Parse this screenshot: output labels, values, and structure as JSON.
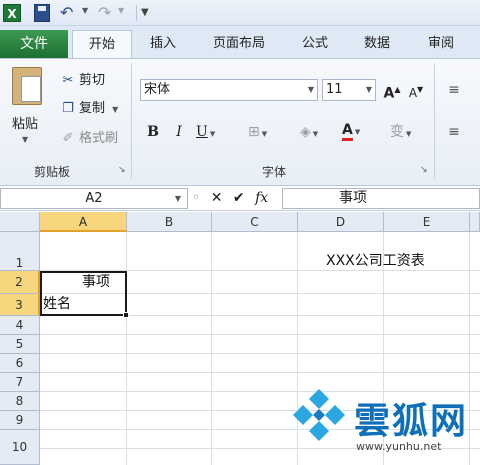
{
  "qat": {
    "logo_letter": "X"
  },
  "tabs": [
    {
      "label": "文件"
    },
    {
      "label": "开始"
    },
    {
      "label": "插入"
    },
    {
      "label": "页面布局"
    },
    {
      "label": "公式"
    },
    {
      "label": "数据"
    },
    {
      "label": "审阅"
    }
  ],
  "ribbon": {
    "clipboard": {
      "paste_label": "粘贴",
      "cut_label": "剪切",
      "copy_label": "复制",
      "format_painter_label": "格式刷",
      "group_label": "剪贴板"
    },
    "font": {
      "font_name": "宋体",
      "font_size": "11",
      "bold": "B",
      "italic": "I",
      "underline": "U",
      "grow": "A",
      "shrink": "A",
      "font_color_letter": "A",
      "phonetic": "变",
      "group_label": "字体"
    },
    "font_color": "#e02020"
  },
  "formula_bar": {
    "name_box": "A2",
    "fx": "fx",
    "formula": "事项"
  },
  "sheet": {
    "columns": [
      "A",
      "B",
      "C",
      "D",
      "E"
    ],
    "rows": [
      "1",
      "2",
      "3",
      "4",
      "5",
      "6",
      "7",
      "8",
      "9",
      "10"
    ],
    "cells": {
      "D1": "XXX公司工资表",
      "A2": "事项",
      "A3": "姓名"
    }
  },
  "watermark": {
    "title": "雲狐网",
    "url": "www.yunhu.net"
  }
}
